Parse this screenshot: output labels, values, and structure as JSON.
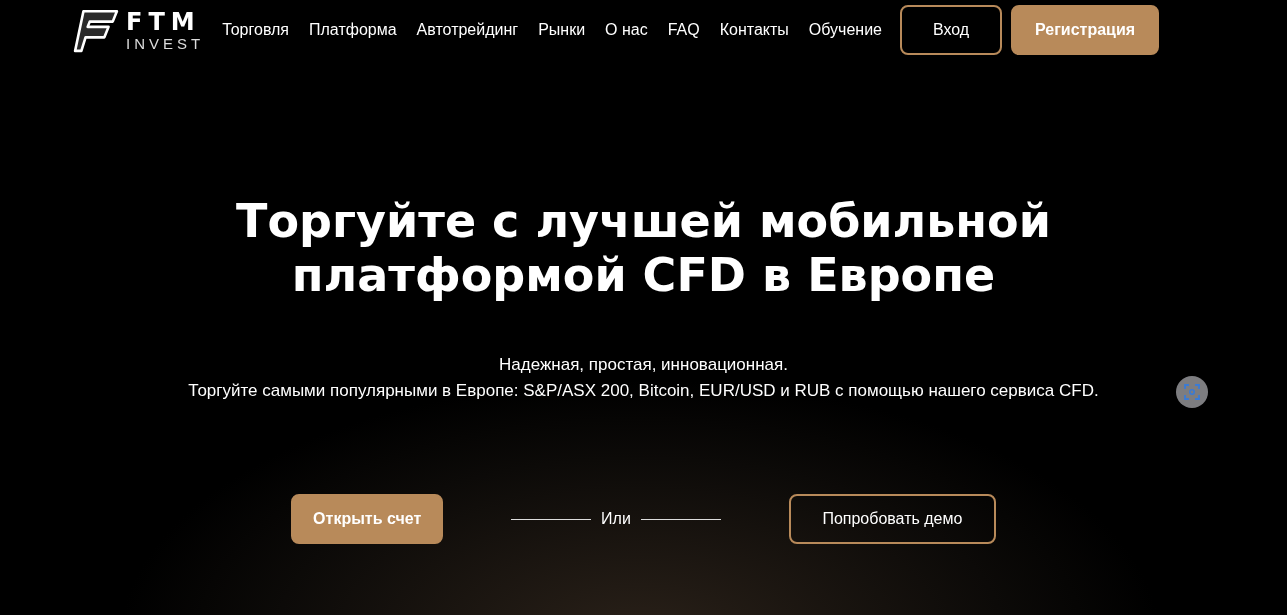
{
  "logo": {
    "title": "FTM",
    "subtitle": "INVEST"
  },
  "nav": [
    "Торговля",
    "Платформа",
    "Автотрейдинг",
    "Рынки",
    "О нас",
    "FAQ",
    "Контакты",
    "Обучение"
  ],
  "auth": {
    "login": "Вход",
    "register": "Регистрация"
  },
  "hero": {
    "title": "Торгуйте с лучшей мобильной платформой CFD в Европе",
    "tagline": "Надежная, простая, инновационная.",
    "description": "Торгуйте самыми популярными в Европе: S&P/ASX 200, Bitcoin, EUR/USD и RUB с помощью нашего сервиса CFD."
  },
  "actions": {
    "primary": "Открыть счет",
    "separator": "Или",
    "secondary": "Попробовать демо"
  }
}
